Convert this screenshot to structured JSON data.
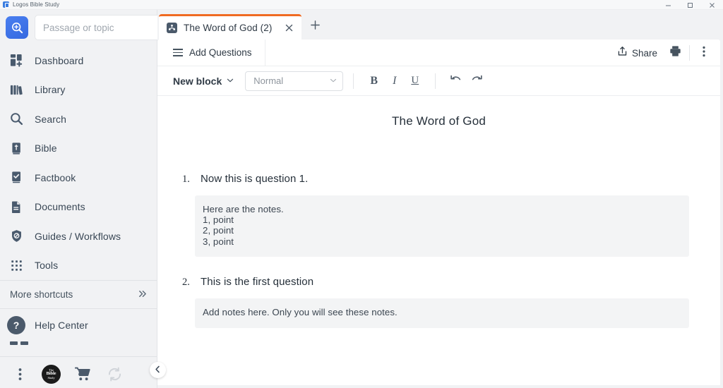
{
  "window": {
    "title": "Logos Bible Study",
    "app_icon": "logos-app-icon",
    "controls": {
      "minimize": "minimize-icon",
      "maximize": "maximize-icon",
      "close": "close-icon"
    }
  },
  "sidebar": {
    "search": {
      "icon": "search-plus-icon",
      "placeholder": "Passage or topic",
      "value": ""
    },
    "items": [
      {
        "label": "Dashboard",
        "icon": "dashboard-icon"
      },
      {
        "label": "Library",
        "icon": "library-icon"
      },
      {
        "label": "Search",
        "icon": "search-icon"
      },
      {
        "label": "Bible",
        "icon": "bible-icon"
      },
      {
        "label": "Factbook",
        "icon": "factbook-icon"
      },
      {
        "label": "Documents",
        "icon": "documents-icon"
      },
      {
        "label": "Guides / Workflows",
        "icon": "guides-workflows-icon"
      },
      {
        "label": "Tools",
        "icon": "tools-icon"
      }
    ],
    "more_shortcuts": {
      "label": "More shortcuts",
      "icon": "chevron-double-right-icon"
    },
    "help_center": {
      "label": "Help Center",
      "icon": "question-mark-icon"
    },
    "bottom_bar": [
      {
        "name": "more-options",
        "icon": "kebab-menu-icon"
      },
      {
        "name": "account-avatar",
        "icon": "avatar-icon",
        "line1": "The",
        "line2": "Bible",
        "line3": "Study"
      },
      {
        "name": "store",
        "icon": "shopping-cart-icon"
      },
      {
        "name": "sync",
        "icon": "refresh-sync-icon"
      }
    ],
    "collapse_button": {
      "icon": "chevron-left-icon"
    }
  },
  "tabs": {
    "items": [
      {
        "label": "The Word of God (2)",
        "icon": "sermon-document-icon",
        "active": true,
        "close_icon": "close-icon",
        "accent_color": "#f06b22"
      }
    ],
    "new_tab": {
      "icon": "plus-icon"
    }
  },
  "header": {
    "add_questions": {
      "label": "Add Questions",
      "icon": "hamburger-icon"
    },
    "share": {
      "label": "Share",
      "icon": "share-upload-icon"
    },
    "print": {
      "icon": "printer-icon"
    },
    "overflow": {
      "icon": "kebab-menu-icon"
    }
  },
  "format_toolbar": {
    "new_block": {
      "label": "New block",
      "icon": "chevron-down-icon"
    },
    "style_select": {
      "value": "Normal",
      "icon": "chevron-down-icon",
      "options": [
        "Normal"
      ]
    },
    "bold": {
      "label": "B",
      "name": "bold-button"
    },
    "italic": {
      "label": "I",
      "name": "italic-button"
    },
    "underline": {
      "label": "U",
      "name": "underline-button"
    },
    "undo": {
      "icon": "undo-icon"
    },
    "redo": {
      "icon": "redo-icon"
    }
  },
  "document": {
    "title": "The Word of God",
    "questions": [
      {
        "number": "1.",
        "text": "Now this is question 1.",
        "notes": "Here are the notes.\n1, point\n2, point\n3, point"
      },
      {
        "number": "2.",
        "text": "This is the first question",
        "notes": "Add notes here. Only you will see these notes."
      }
    ]
  },
  "colors": {
    "accent_orange": "#f06b22",
    "sidebar_bg": "#f1f2f4",
    "icon_navy": "#495a6d",
    "note_bg": "#f3f4f5",
    "search_blue": "#3569e0"
  }
}
